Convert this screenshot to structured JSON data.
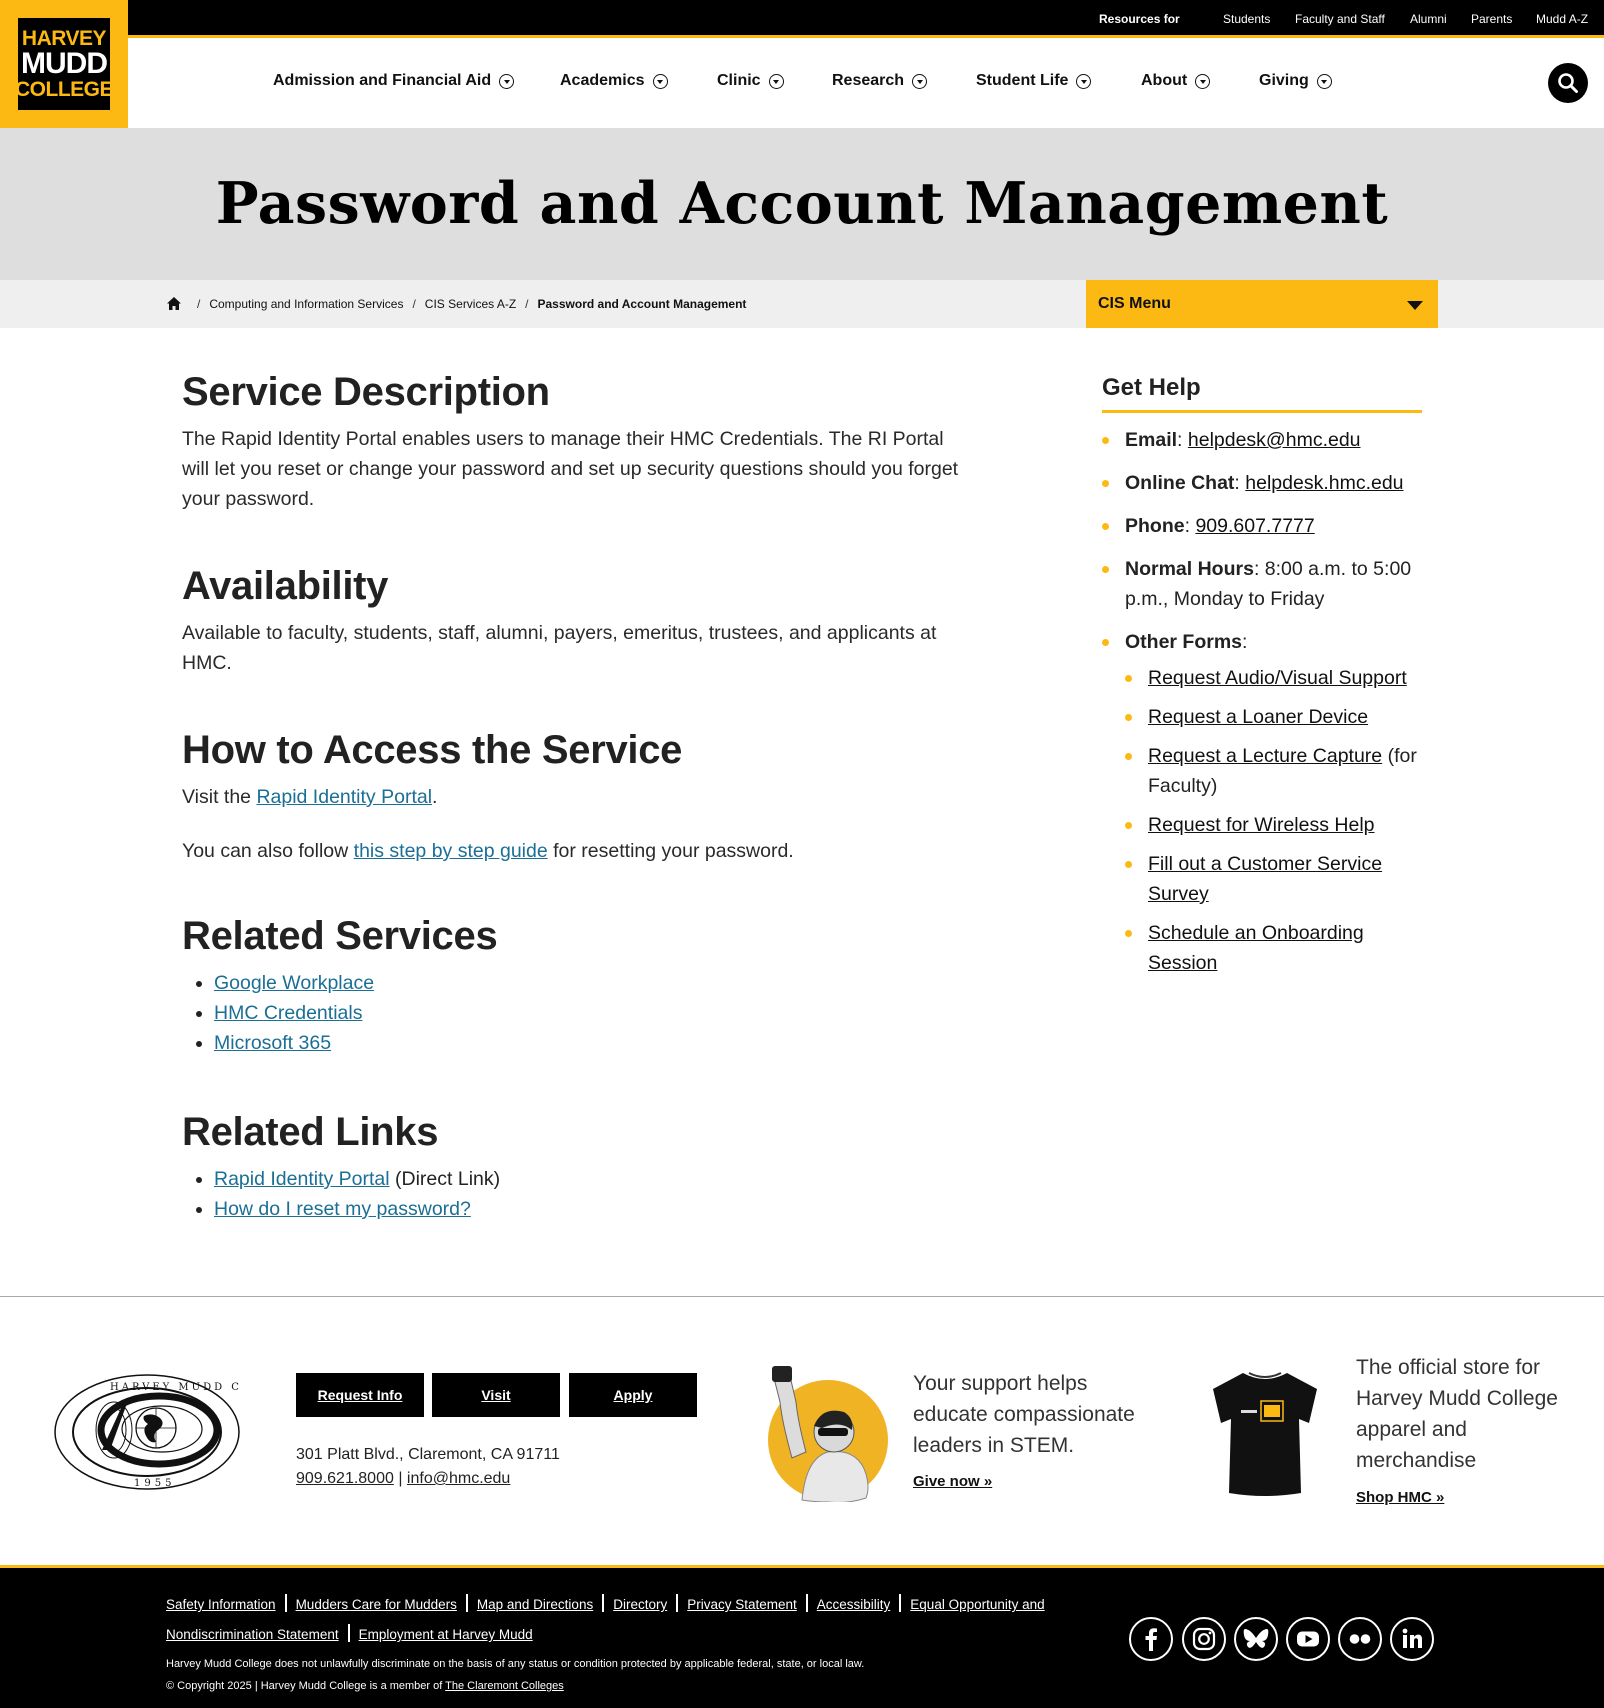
{
  "brand": {
    "line1": "HARVEY",
    "line2": "MUDD",
    "line3": "COLLEGE",
    "accent_color": "#fdb913"
  },
  "utility": {
    "label": "Resources for",
    "links": [
      "Students",
      "Faculty and Staff",
      "Alumni",
      "Parents",
      "Mudd A-Z"
    ]
  },
  "nav": {
    "items": [
      "Admission and Financial Aid",
      "Academics",
      "Clinic",
      "Research",
      "Student Life",
      "About",
      "Giving"
    ],
    "search_icon": "search-icon"
  },
  "page": {
    "title": "Password and Account Management"
  },
  "breadcrumb": {
    "home_icon": "home-icon",
    "items": [
      "Computing and Information Services",
      "CIS Services A-Z",
      "Password and Account Management"
    ]
  },
  "cis_menu": {
    "label": "CIS Menu"
  },
  "main": {
    "service_description": {
      "heading": "Service Description",
      "body": "The Rapid Identity Portal enables users to manage their HMC Credentials. The RI Portal will let you reset or change your password and set up security questions should you forget your password."
    },
    "availability": {
      "heading": "Availability",
      "body": "Available to faculty, students, staff, alumni, payers, emeritus, trustees, and applicants at HMC."
    },
    "access": {
      "heading": "How to Access the Service",
      "visit_prefix": "Visit the ",
      "visit_link": "Rapid Identity Portal",
      "visit_suffix": ".",
      "guide_prefix": "You can also follow ",
      "guide_link": "this step by step guide",
      "guide_suffix": " for resetting your password."
    },
    "related_services": {
      "heading": "Related Services",
      "items": [
        "Google Workplace",
        "HMC Credentials",
        "Microsoft 365"
      ]
    },
    "related_links": {
      "heading": "Related Links",
      "item1_link": "Rapid Identity Portal",
      "item1_suffix": " (Direct Link)",
      "item2_link": "How do I reset my password?"
    }
  },
  "sidebar": {
    "heading": "Get Help",
    "email_label": "Email",
    "email_value": "helpdesk@hmc.edu",
    "chat_label": "Online Chat",
    "chat_value": "helpdesk.hmc.edu",
    "phone_label": "Phone",
    "phone_value": "909.607.7777",
    "hours_label": "Normal Hours",
    "hours_value": ": 8:00 a.m. to 5:00 p.m., Monday to Friday",
    "forms_label": "Other Forms",
    "forms": [
      {
        "link": "Request Audio/Visual Support",
        "note": ""
      },
      {
        "link": "Request a Loaner Device",
        "note": ""
      },
      {
        "link": "Request a Lecture Capture",
        "note": " (for Faculty)"
      },
      {
        "link": "Request for Wireless Help",
        "note": ""
      },
      {
        "link": "Fill out a Customer Service Survey",
        "note": ""
      },
      {
        "link": "Schedule an Onboarding Session",
        "note": ""
      }
    ]
  },
  "footer": {
    "buttons": [
      "Request Info",
      "Visit",
      "Apply"
    ],
    "address": "301 Platt Blvd., Claremont, CA 91711",
    "phone": "909.621.8000",
    "separator": " | ",
    "email": "info@hmc.edu",
    "seal_text_top": "HARVEY MUDD COLLEGE",
    "seal_year": "1955",
    "support_text": "Your support helps educate compassionate leaders in STEM.",
    "give_link": "Give now »",
    "store_text": "The official store for Harvey Mudd College apparel and merchandise",
    "shop_link": "Shop HMC »"
  },
  "bottom": {
    "links": [
      "Safety Information",
      "Mudders Care for Mudders",
      "Map and Directions",
      "Directory",
      "Privacy Statement",
      "Accessibility",
      "Equal Opportunity and Nondiscrimination Statement",
      "Employment at Harvey Mudd"
    ],
    "disclaimer": "Harvey Mudd College does not unlawfully discriminate on the basis of any status or condition protected by applicable federal, state, or local law.",
    "copyright_prefix": "© Copyright 2025 | Harvey Mudd College is a member of ",
    "copyright_link": "The Claremont Colleges",
    "social_icons": [
      "facebook-icon",
      "instagram-icon",
      "bluesky-icon",
      "youtube-icon",
      "flickr-icon",
      "linkedin-icon"
    ]
  }
}
